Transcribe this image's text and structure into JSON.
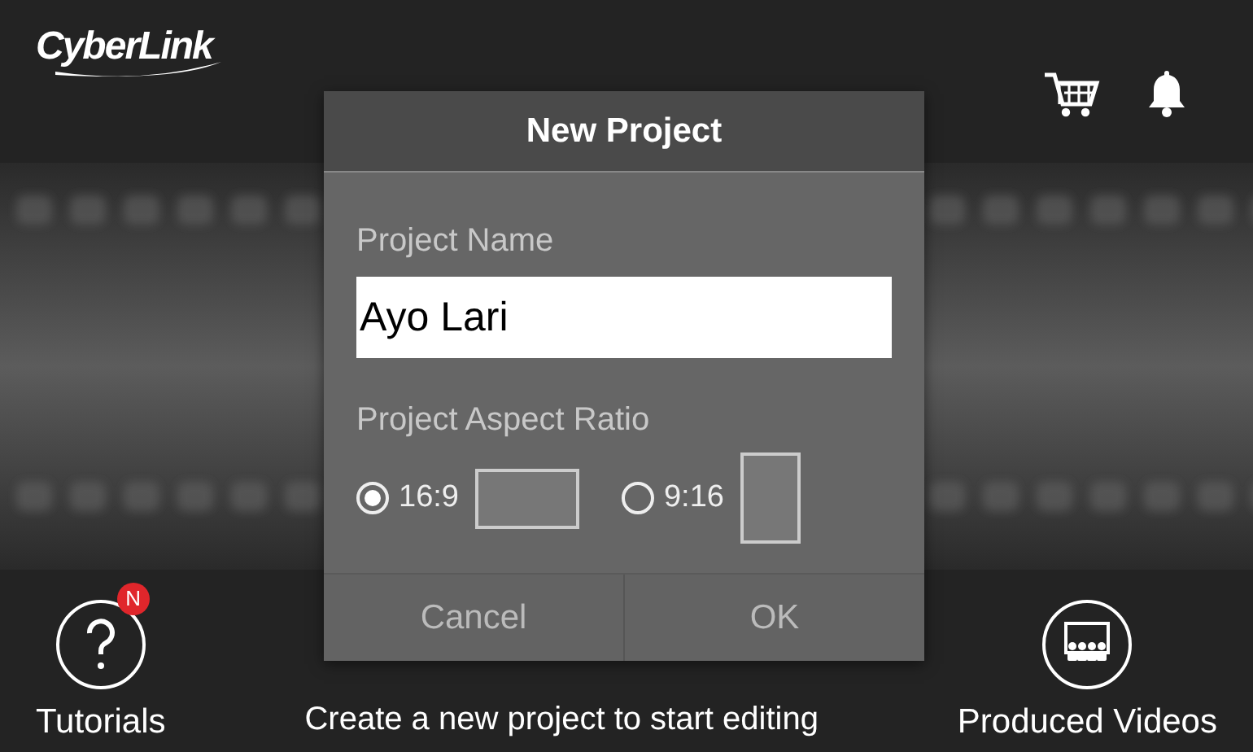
{
  "header": {
    "logo": "CyberLink"
  },
  "bottom": {
    "items": [
      {
        "kind": "tutorials",
        "label": "Tutorials",
        "badge": "N"
      },
      {
        "kind": "videos",
        "label": "Produced Videos"
      }
    ],
    "hint": "Create a new project to start editing"
  },
  "dialog": {
    "title": "New Project",
    "name_label": "Project Name",
    "name_value": "Ayo Lari",
    "ratio_label": "Project Aspect Ratio",
    "ratios": [
      {
        "label": "16:9",
        "kind": "landscape",
        "selected": true
      },
      {
        "label": "9:16",
        "kind": "portrait",
        "selected": false
      }
    ],
    "buttons": [
      "Cancel",
      "OK"
    ]
  }
}
